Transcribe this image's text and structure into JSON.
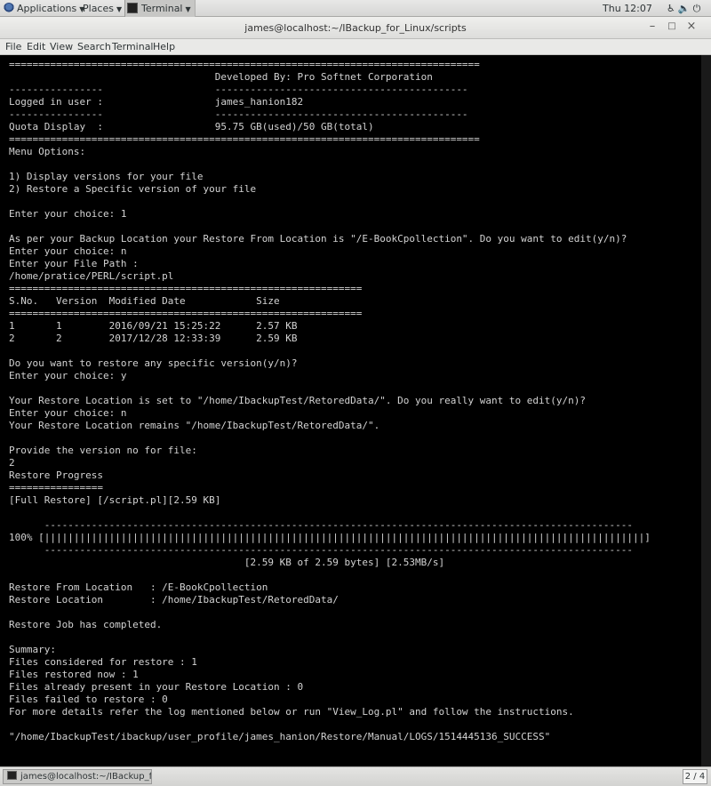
{
  "top_panel": {
    "applications": "Applications",
    "places": "Places",
    "terminal_task": "Terminal",
    "clock": "Thu 12:07"
  },
  "window": {
    "title": "james@localhost:~/IBackup_for_Linux/scripts",
    "minimize": "–",
    "maximize": "□",
    "close": "×"
  },
  "menu": {
    "file": "File",
    "edit": "Edit",
    "view": "View",
    "search": "Search",
    "terminal": "Terminal",
    "help": "Help"
  },
  "terminal": {
    "lines": [
      "================================================================================",
      "                                   Developed By: Pro Softnet Corporation",
      "----------------                   -------------------------------------------",
      "Logged in user :                   james_hanion182",
      "----------------                   -------------------------------------------",
      "Quota Display  :                   95.75 GB(used)/50 GB(total)",
      "================================================================================",
      "Menu Options:",
      "",
      "1) Display versions for your file",
      "2) Restore a Specific version of your file",
      "",
      "Enter your choice: 1",
      "",
      "As per your Backup Location your Restore From Location is \"/E-BookCpollection\". Do you want to edit(y/n)?",
      "Enter your choice: n",
      "Enter your File Path :",
      "/home/pratice/PERL/script.pl",
      "============================================================",
      "S.No.   Version  Modified Date            Size",
      "============================================================",
      "1       1        2016/09/21 15:25:22      2.57 KB",
      "2       2        2017/12/28 12:33:39      2.59 KB",
      "",
      "Do you want to restore any specific version(y/n)?",
      "Enter your choice: y",
      "",
      "Your Restore Location is set to \"/home/IbackupTest/RetoredData/\". Do you really want to edit(y/n)?",
      "Enter your choice: n",
      "Your Restore Location remains \"/home/IbackupTest/RetoredData/\".",
      "",
      "Provide the version no for file:",
      "2",
      "Restore Progress",
      "================",
      "[Full Restore] [/script.pl][2.59 KB]",
      "",
      "      ----------------------------------------------------------------------------------------------------",
      "100% [||||||||||||||||||||||||||||||||||||||||||||||||||||||||||||||||||||||||||||||||||||||||||||||||||||||]",
      "      ----------------------------------------------------------------------------------------------------",
      "                                        [2.59 KB of 2.59 bytes] [2.53MB/s]",
      "",
      "Restore From Location   : /E-BookCpollection",
      "Restore Location        : /home/IbackupTest/RetoredData/",
      "",
      "Restore Job has completed.",
      "",
      "Summary:",
      "Files considered for restore : 1",
      "Files restored now : 1",
      "Files already present in your Restore Location : 0",
      "Files failed to restore : 0",
      "For more details refer the log mentioned below or run \"View_Log.pl\" and follow the instructions.",
      "",
      "\"/home/IbackupTest/ibackup/user_profile/james_hanion/Restore/Manual/LOGS/1514445136_SUCCESS\""
    ]
  },
  "bottom_panel": {
    "task": "james@localhost:~/IBackup_for_Li...",
    "workspace": "2 / 4"
  }
}
